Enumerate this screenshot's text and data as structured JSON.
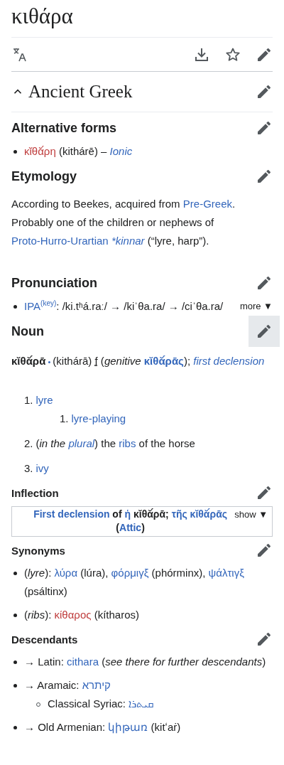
{
  "title": "κιθάρα",
  "language": {
    "name": "Ancient Greek",
    "expanded": true
  },
  "sections": [
    {
      "heading": "Alternative forms",
      "kind": "major",
      "edit_pressed": false,
      "blocks": [
        {
          "kind": "bullets",
          "items": [
            {
              "segments": [
                {
                  "text": "κῐθᾰ́ρη",
                  "kind": "redlink"
                },
                {
                  "text": " (kithárē) – ",
                  "kind": "text"
                },
                {
                  "text": "Ionic",
                  "kind": "link",
                  "italic": true
                }
              ]
            }
          ]
        }
      ]
    },
    {
      "heading": "Etymology",
      "kind": "major",
      "edit_pressed": false,
      "blocks": [
        {
          "kind": "paragraph",
          "segments": [
            {
              "text": "According to Beekes, acquired from ",
              "kind": "text"
            },
            {
              "text": "Pre-Greek",
              "kind": "link"
            },
            {
              "text": ". Probably one of the children or nephews of ",
              "kind": "text"
            },
            {
              "text": "Proto-Hurro-Urartian",
              "kind": "link"
            },
            {
              "text": "*kinnar",
              "kind": "link",
              "italic": true,
              "spaced": true
            },
            {
              "text": " (“lyre, harp”).",
              "kind": "text"
            }
          ]
        }
      ]
    },
    {
      "heading": "Pronunciation",
      "kind": "major",
      "edit_pressed": false,
      "blocks": [
        {
          "kind": "bullets",
          "items": [
            {
              "segments": [
                {
                  "text": "IPA",
                  "kind": "link"
                },
                {
                  "text": "(key)",
                  "kind": "link",
                  "raised": true
                },
                {
                  "text": ": /ki.tʰá.raː/ → /kiˈθa.ra/ → /ciˈθa.ra/",
                  "kind": "text"
                }
              ],
              "toggle": "more ▼"
            }
          ]
        }
      ]
    },
    {
      "heading": "Noun",
      "kind": "major",
      "edit_pressed": true,
      "blocks": [
        {
          "kind": "paragraph",
          "segments": [
            {
              "text": "κῐθᾰ́ρᾱ",
              "kind": "headword"
            },
            {
              "text": " • ",
              "kind": "separator"
            },
            {
              "text": "(kithárā) ",
              "kind": "text"
            },
            {
              "text": "f",
              "kind": "abbr"
            },
            {
              "text": " (*genitive* ",
              "kind": "text"
            },
            {
              "text": "κῐθᾰ́ρᾱς",
              "kind": "link",
              "bold": true
            },
            {
              "text": "); ",
              "kind": "text"
            },
            {
              "text": "first declension",
              "kind": "link",
              "italic": true
            }
          ]
        },
        {
          "kind": "numbered",
          "items": [
            {
              "number": "1.",
              "segments": [
                {
                  "text": "lyre",
                  "kind": "link"
                }
              ],
              "children": [
                {
                  "number": "1.",
                  "segments": [
                    {
                      "text": "lyre-playing",
                      "kind": "link"
                    }
                  ]
                }
              ]
            },
            {
              "number": "2.",
              "segments": [
                {
                  "text": "(*in the* ",
                  "kind": "text"
                },
                {
                  "text": "plural",
                  "kind": "link",
                  "italic": true
                },
                {
                  "text": ") the ",
                  "kind": "text"
                },
                {
                  "text": "ribs",
                  "kind": "link"
                },
                {
                  "text": " of the horse",
                  "kind": "text"
                }
              ]
            },
            {
              "number": "3.",
              "segments": [
                {
                  "text": "ivy",
                  "kind": "link"
                }
              ]
            }
          ]
        }
      ]
    },
    {
      "heading": "Inflection",
      "kind": "minor",
      "edit_pressed": false,
      "blocks": [
        {
          "kind": "navbox",
          "segments": [
            {
              "text": "First declension",
              "kind": "link"
            },
            {
              "text": " of ",
              "kind": "text"
            },
            {
              "text": "ἡ",
              "kind": "link"
            },
            {
              "text": " κῐθᾰ́ρᾱ; ",
              "kind": "text"
            },
            {
              "text": "τῆς κῐθᾰ́ρᾱς",
              "kind": "link"
            },
            {
              "text": " (",
              "kind": "text"
            },
            {
              "text": "Attic",
              "kind": "link"
            },
            {
              "text": ")",
              "kind": "text"
            }
          ],
          "toggle": "show ▼"
        }
      ]
    },
    {
      "heading": "Synonyms",
      "kind": "minor",
      "edit_pressed": false,
      "blocks": [
        {
          "kind": "bullets",
          "items": [
            {
              "segments": [
                {
                  "text": "(*lyre*): ",
                  "kind": "text"
                },
                {
                  "text": "λύρα",
                  "kind": "link"
                },
                {
                  "text": " (lúra), ",
                  "kind": "text"
                },
                {
                  "text": "φόρμιγξ",
                  "kind": "link"
                },
                {
                  "text": " (phórminx), ",
                  "kind": "text"
                },
                {
                  "text": "ψάλτιγξ",
                  "kind": "link"
                },
                {
                  "text": " (psáltinx)",
                  "kind": "text"
                }
              ]
            },
            {
              "segments": [
                {
                  "text": "(*ribs*): ",
                  "kind": "text"
                },
                {
                  "text": "κίθαρος",
                  "kind": "redlink"
                },
                {
                  "text": " (kítharos)",
                  "kind": "text"
                }
              ]
            }
          ]
        }
      ]
    },
    {
      "heading": "Descendants",
      "kind": "minor",
      "edit_pressed": false,
      "blocks": [
        {
          "kind": "bullets",
          "items": [
            {
              "segments": [
                {
                  "text": "→ Latin: ",
                  "kind": "text"
                },
                {
                  "text": "cithara",
                  "kind": "link"
                },
                {
                  "text": " (*see there for further descendants*)",
                  "kind": "text"
                }
              ]
            },
            {
              "segments": [
                {
                  "text": "→ Aramaic: ",
                  "kind": "text"
                },
                {
                  "text": "קיתרא",
                  "kind": "link"
                }
              ],
              "children": [
                {
                  "segments": [
                    {
                      "text": "Classical Syriac: ",
                      "kind": "text"
                    },
                    {
                      "text": "ܩܝܬܪܐ",
                      "kind": "link"
                    }
                  ]
                }
              ]
            },
            {
              "segments": [
                {
                  "text": "→ Old Armenian: ",
                  "kind": "text"
                },
                {
                  "text": "կիթառ",
                  "kind": "link"
                },
                {
                  "text": " (kitʻaṙ)",
                  "kind": "text"
                }
              ]
            }
          ]
        }
      ]
    }
  ]
}
